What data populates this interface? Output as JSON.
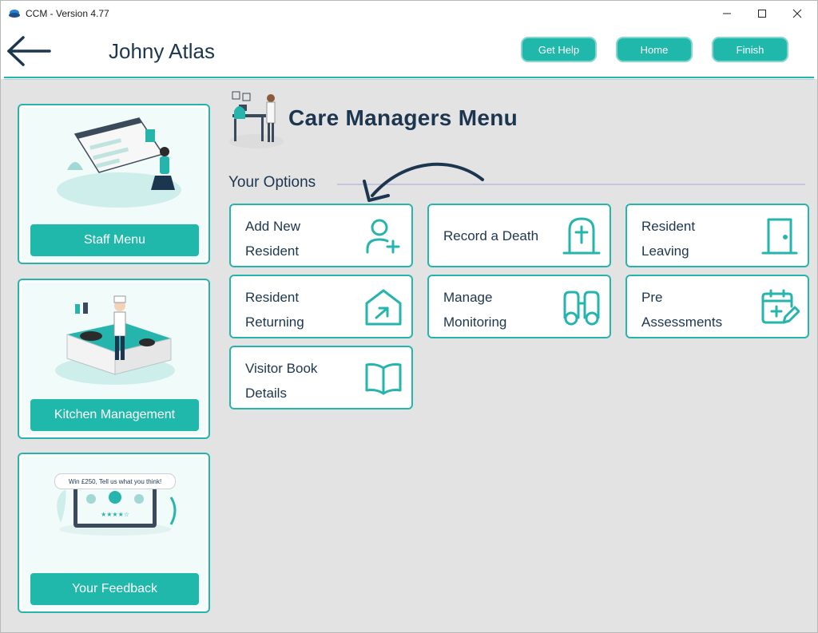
{
  "window": {
    "title": "CCM - Version 4.77"
  },
  "header": {
    "user_name": "Johny Atlas",
    "buttons": {
      "help": "Get Help",
      "home": "Home",
      "finish": "Finish"
    }
  },
  "sidebar": {
    "cards": [
      {
        "label": "Staff Menu"
      },
      {
        "label": "Kitchen Management"
      },
      {
        "label": "Your Feedback",
        "banner": "Win £250, Tell us what you think!"
      }
    ]
  },
  "main": {
    "title": "Care Managers Menu",
    "options_heading": "Your Options",
    "options": [
      {
        "line1": "Add New",
        "line2": "Resident",
        "icon": "add-person-icon"
      },
      {
        "line1": "Record a Death",
        "line2": "",
        "icon": "gravestone-icon"
      },
      {
        "line1": "Resident",
        "line2": "Leaving",
        "icon": "door-icon"
      },
      {
        "line1": "Resident",
        "line2": "Returning",
        "icon": "house-return-icon"
      },
      {
        "line1": "Manage",
        "line2": "Monitoring",
        "icon": "binoculars-icon"
      },
      {
        "line1": "Pre",
        "line2": "Assessments",
        "icon": "calendar-edit-icon"
      },
      {
        "line1": "Visitor Book",
        "line2": "Details",
        "icon": "open-book-icon"
      }
    ]
  },
  "colors": {
    "accent": "#1fb8ab",
    "border": "#26b5ad",
    "text": "#1d3650"
  }
}
